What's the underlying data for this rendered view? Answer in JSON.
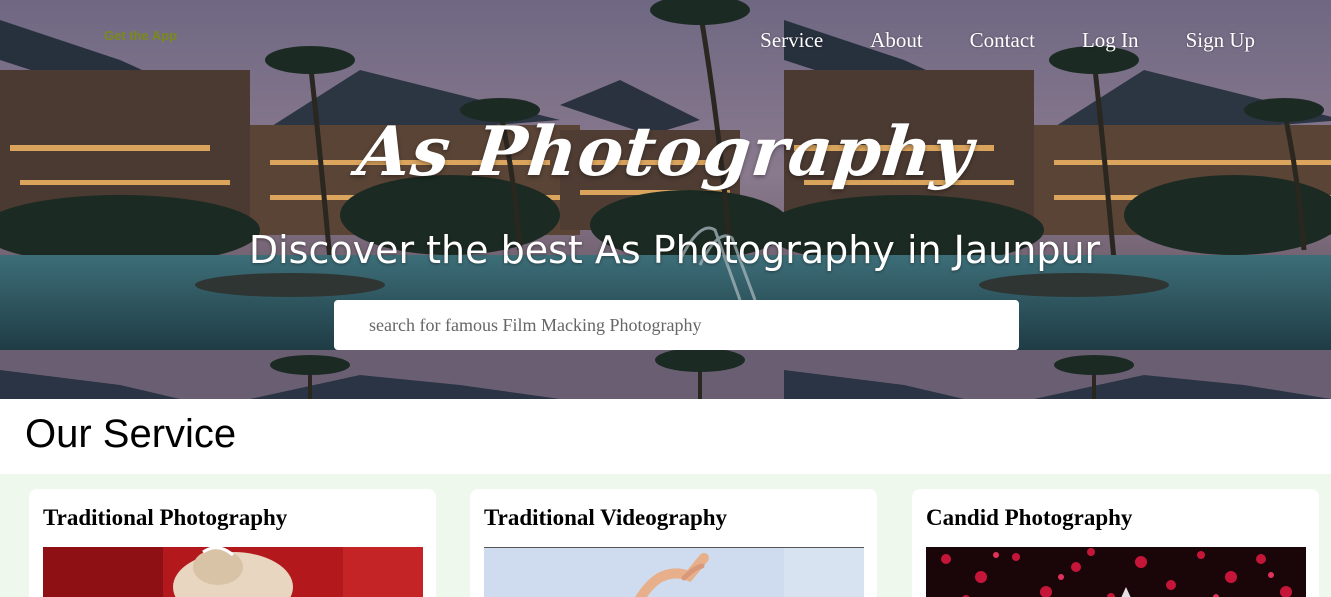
{
  "header": {
    "get_app": "Get the App",
    "nav": [
      "Service",
      "About",
      "Contact",
      "Log In",
      "Sign Up"
    ]
  },
  "hero": {
    "brand": "As Photography",
    "tagline": "Discover the best As Photography in Jaunpur",
    "search_placeholder": "search for famous Film Macking Photography"
  },
  "services": {
    "title": "Our Service",
    "cards": [
      {
        "title": "Traditional Photography"
      },
      {
        "title": "Traditional Videography"
      },
      {
        "title": "Candid Photography"
      }
    ]
  },
  "colors": {
    "get_app": "#7a8a1a",
    "service_bg": "#eef8ec",
    "text_white": "#ffffff"
  }
}
